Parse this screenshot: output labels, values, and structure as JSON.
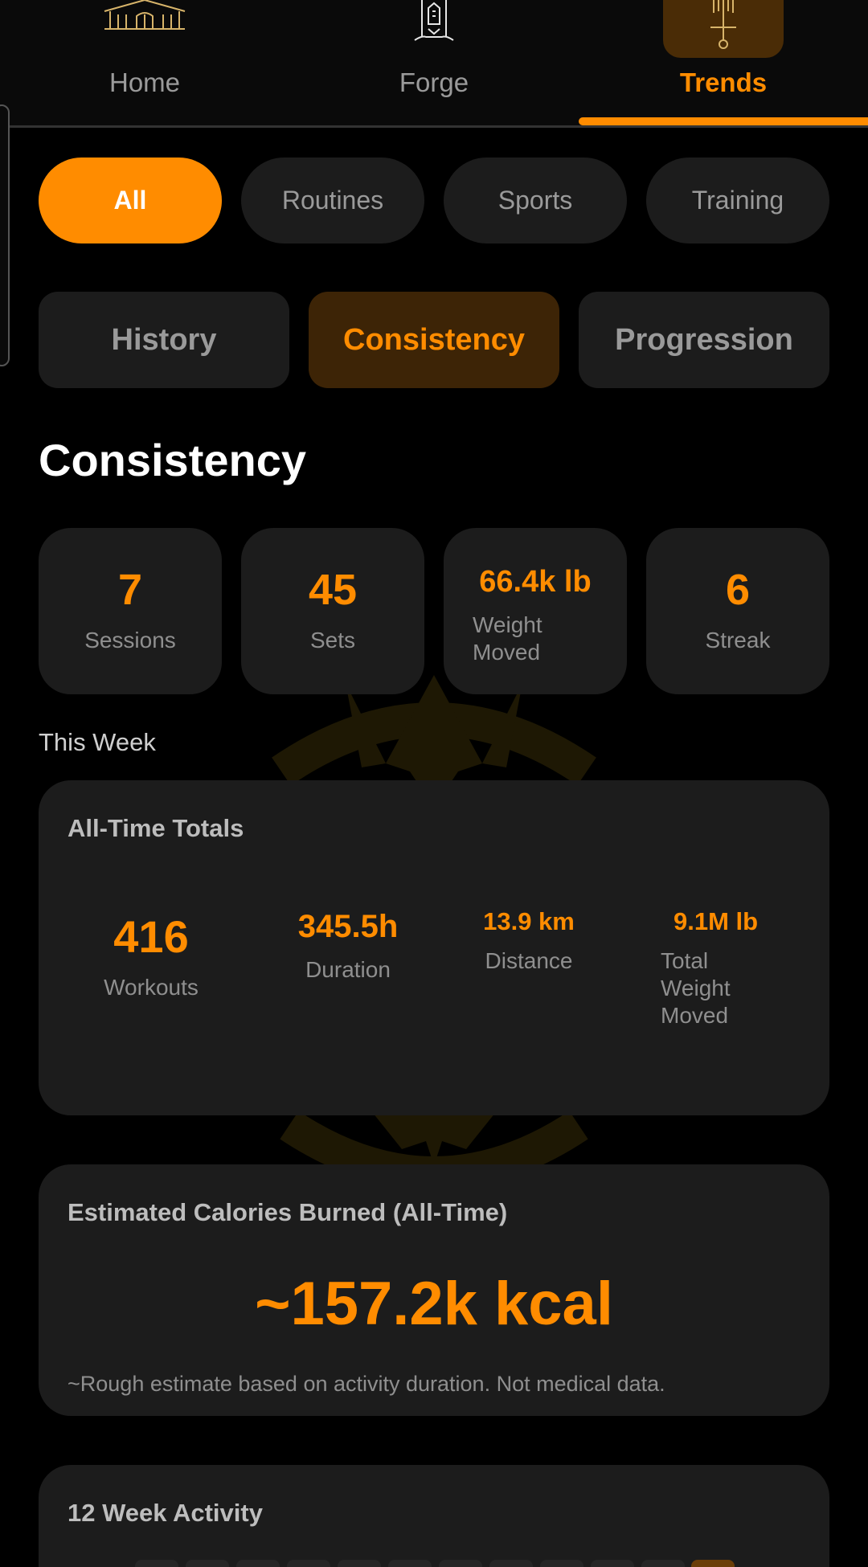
{
  "nav": {
    "tabs": [
      {
        "label": "Home",
        "icon": "hall-icon"
      },
      {
        "label": "Forge",
        "icon": "tower-icon"
      },
      {
        "label": "Trends",
        "icon": "sword-icon",
        "active": true
      }
    ]
  },
  "filters": [
    "All",
    "Routines",
    "Sports",
    "Training"
  ],
  "active_filter": "All",
  "segments": [
    "History",
    "Consistency",
    "Progression"
  ],
  "active_segment": "Consistency",
  "page_title": "Consistency",
  "stats": [
    {
      "value": "7",
      "label": "Sessions"
    },
    {
      "value": "45",
      "label": "Sets"
    },
    {
      "value": "66.4k lb",
      "label": "Weight Moved"
    },
    {
      "value": "6",
      "label": "Streak"
    }
  ],
  "week_label": "This Week",
  "totals": {
    "title": "All-Time Totals",
    "items": [
      {
        "value": "416",
        "label": "Workouts"
      },
      {
        "value": "345.5h",
        "label": "Duration"
      },
      {
        "value": "13.9 km",
        "label": "Distance"
      },
      {
        "value": "9.1M lb",
        "label": "Total Weight Moved"
      }
    ]
  },
  "calories": {
    "title": "Estimated Calories Burned (All-Time)",
    "value": "~157.2k kcal",
    "note": "~Rough estimate based on activity duration. Not medical data."
  },
  "activity": {
    "title": "12 Week Activity"
  },
  "colors": {
    "accent": "#ff8c00",
    "card": "#1c1c1c",
    "background": "#000000",
    "muted_text": "#8f8f8f"
  }
}
